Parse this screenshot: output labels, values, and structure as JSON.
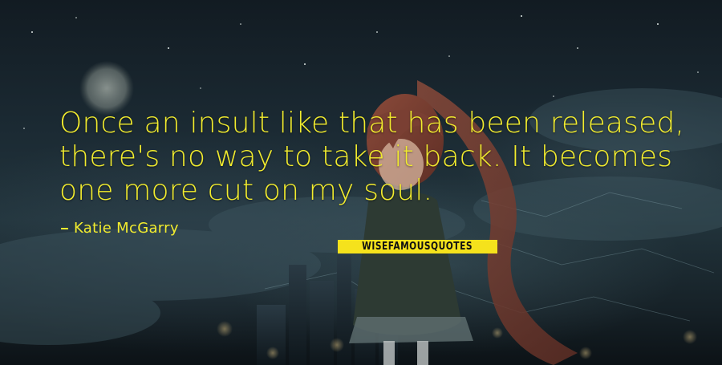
{
  "quote": {
    "lines": [
      "Once an insult like that has been released,",
      "there's no way to take it back. It becomes",
      "one more cut on my soul."
    ]
  },
  "author": {
    "name": "Katie McGarry"
  },
  "brand": {
    "logo_text": "WISEFAMOUSQUOTES"
  },
  "colors": {
    "text": "#f2ec2e",
    "logo_background": "#f5e21c",
    "logo_text": "#111111"
  },
  "icons": {
    "author_prefix": "dash-icon"
  }
}
